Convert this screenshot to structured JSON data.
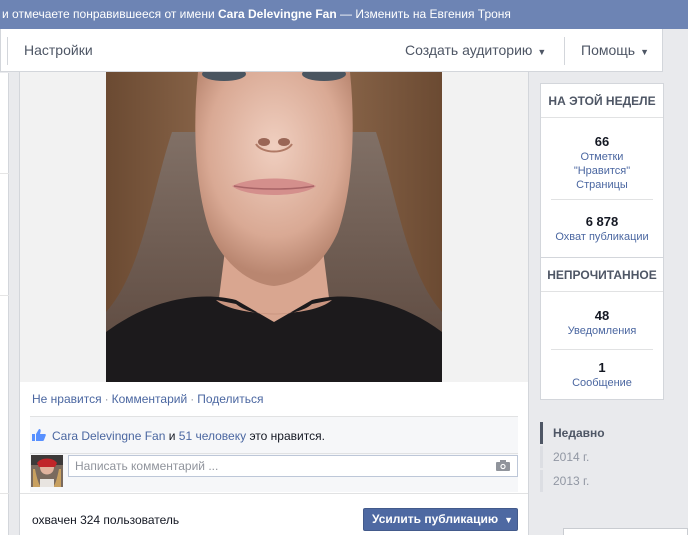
{
  "topbar": {
    "prefix": "и отмечаете понравившееся от имени ",
    "page_name": "Cara Delevingne Fan",
    "suffix": " — Изменить на Евгения Троня"
  },
  "nav": {
    "settings": "Настройки",
    "create_audience": "Создать аудиторию",
    "help": "Помощь"
  },
  "post": {
    "actions": {
      "unlike": "Не нравится",
      "comment": "Комментарий",
      "share": "Поделиться",
      "separator": "·"
    },
    "likes": {
      "page_name": "Cara Delevingne Fan",
      "conj": " и ",
      "others": "51 человеку",
      "suffix": " это нравится."
    },
    "comment_placeholder": "Написать комментарий ...",
    "reach_text": "охвачен 324 пользователь",
    "boost_label": "Усилить публикацию"
  },
  "stats": {
    "week_header": "НА ЭТОЙ НЕДЕЛЕ",
    "likes_count": "66",
    "likes_label_1": "Отметки",
    "likes_label_2": "\"Нравится\"",
    "likes_label_3": "Страницы",
    "reach_count": "6 878",
    "reach_label": "Охват публикации",
    "unread_header": "НЕПРОЧИТАННОЕ",
    "notifications_count": "48",
    "notifications_label": "Уведомления",
    "messages_count": "1",
    "messages_label": "Сообщение"
  },
  "timeline": {
    "recent": "Недавно",
    "year_2014": "2014 г.",
    "year_2013": "2013 г."
  },
  "colors": {
    "topbar": "#6d84b4",
    "link": "#4b67a1",
    "boost_button": "#4e69a2",
    "background": "#e9eaed"
  },
  "icons": {
    "like": "thumbs-up-icon",
    "camera": "camera-icon",
    "caret": "caret-down-icon"
  }
}
